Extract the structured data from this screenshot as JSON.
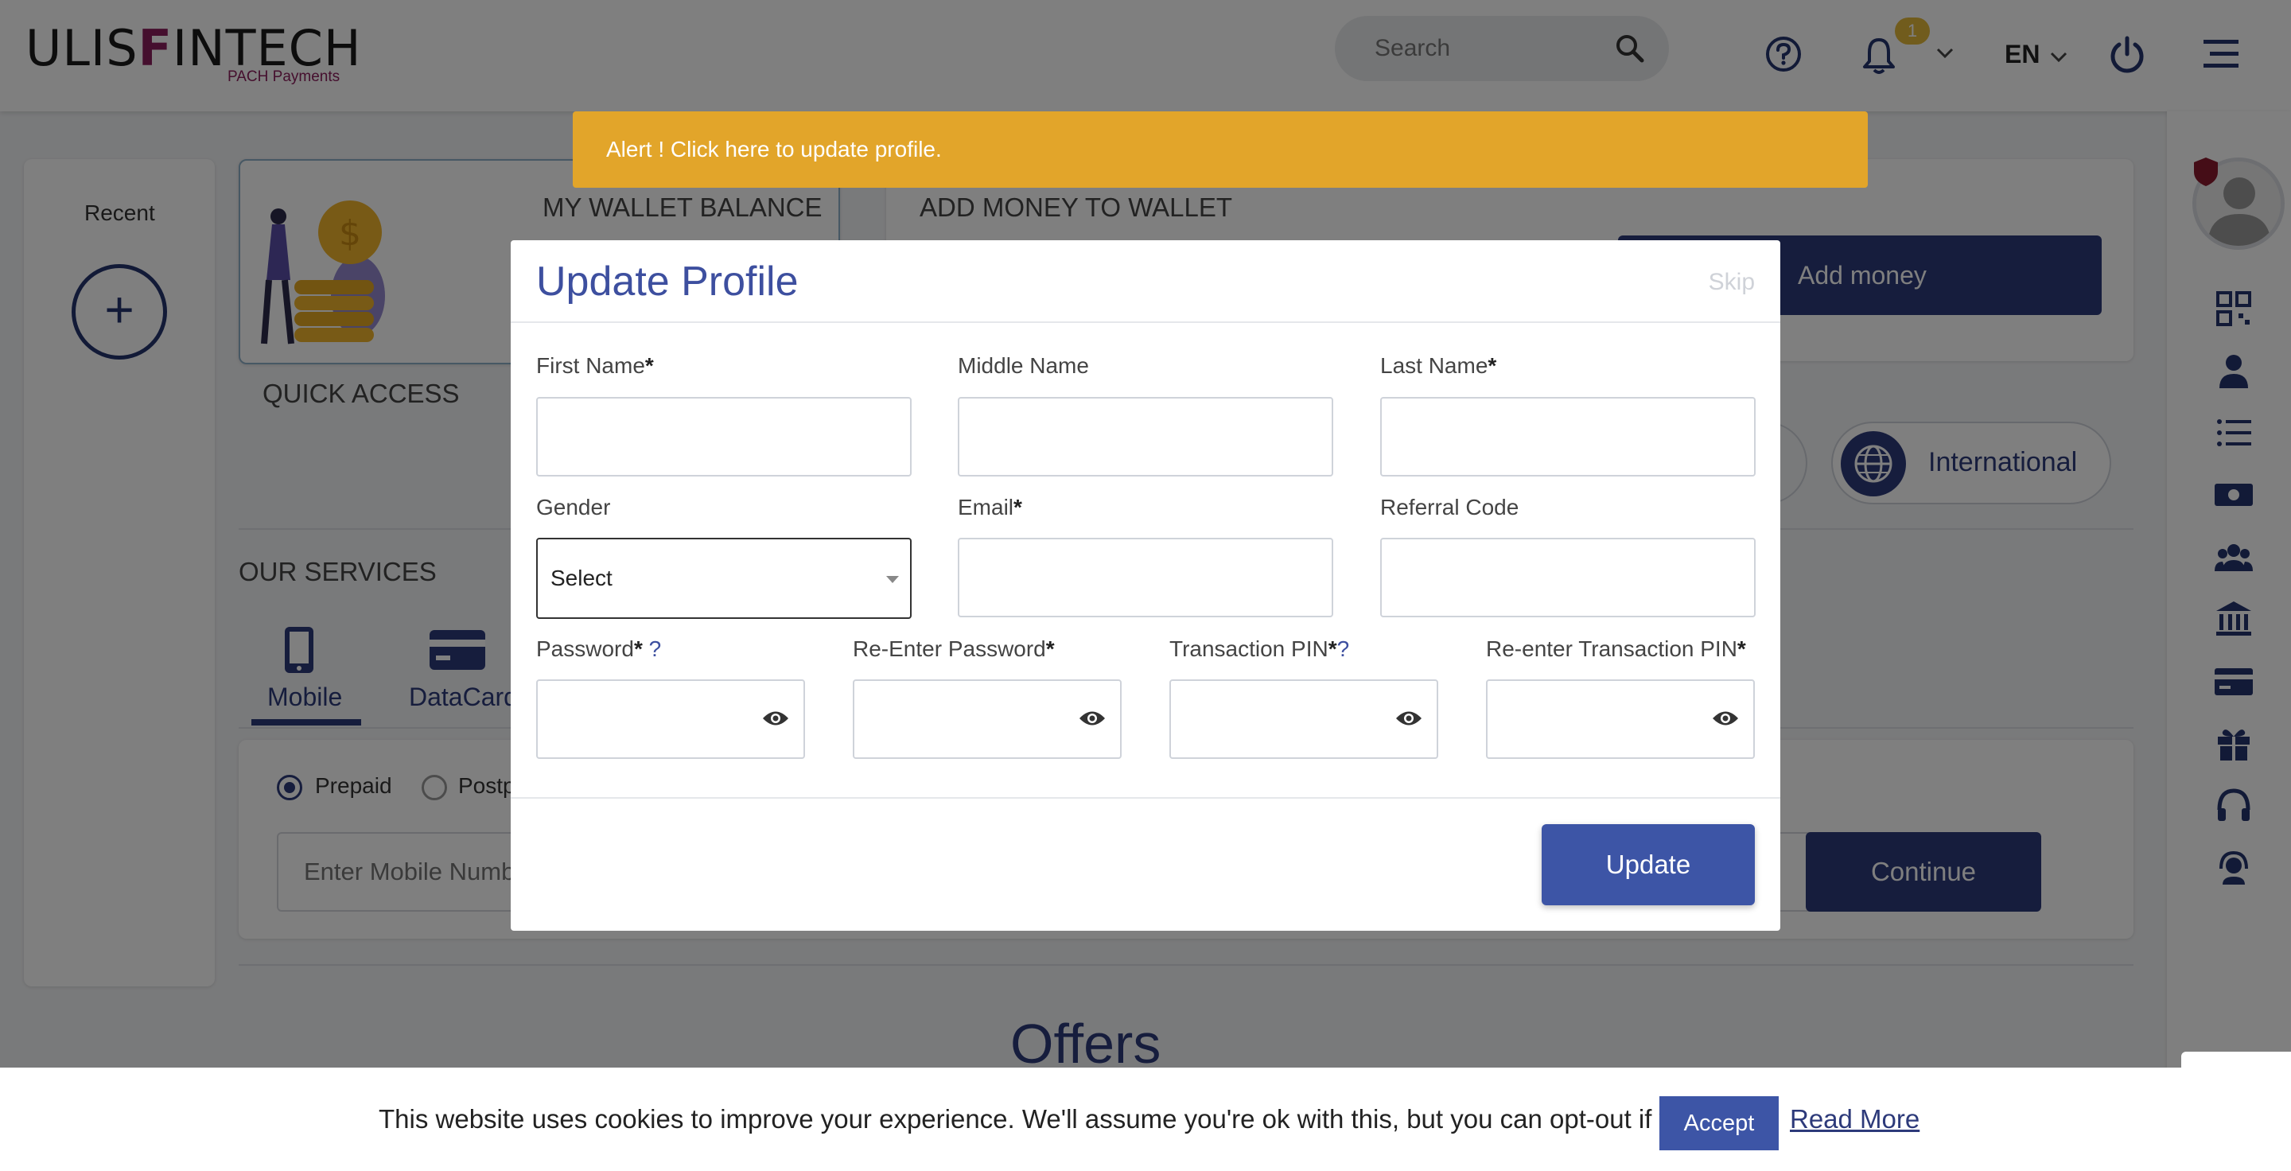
{
  "header": {
    "logo_text_1": "ULIS",
    "logo_text_f": "F",
    "logo_text_2": "INTECH",
    "logo_sub": "PACH Payments",
    "search_placeholder": "Search",
    "notification_count": "1",
    "language": "EN"
  },
  "alert": {
    "text": "Alert ! Click here to update profile."
  },
  "dashboard": {
    "recent_title": "Recent",
    "add_icon": "+",
    "wallet_balance_title": "MY WALLET BALANCE",
    "add_money_title": "ADD MONEY TO WALLET",
    "add_money_button": "Add money",
    "quick_access_title": "QUICK ACCESS",
    "international_label": "International",
    "services_title": "OUR SERVICES",
    "service_tabs": [
      "Mobile",
      "DataCard"
    ],
    "radio_prepaid": "Prepaid",
    "radio_postpaid_partial": "Postp",
    "mobile_input_placeholder": "Enter Mobile Number",
    "continue_button": "Continue",
    "offers_title": "Offers"
  },
  "modal": {
    "title": "Update Profile",
    "skip": "Skip",
    "fields": {
      "first_name": "First Name",
      "middle_name": "Middle Name",
      "last_name": "Last Name",
      "gender": "Gender",
      "email": "Email",
      "referral_code": "Referral Code",
      "password": "Password",
      "reenter_password": "Re-Enter Password",
      "transaction_pin": "Transaction PIN",
      "reenter_transaction_pin": "Re-enter Transaction PIN"
    },
    "required_mark": "*",
    "help_mark": "?",
    "gender_selected": "Select",
    "update_button": "Update"
  },
  "cookie": {
    "text": "This website uses cookies to improve your experience. We'll assume you're ok with this, but you can opt-out if you wish.",
    "accept": "Accept",
    "read_more": "Read More"
  },
  "colors": {
    "brand_navy": "#2d3a7a",
    "modal_blue": "#3d55a6",
    "alert_amber": "#e2a52a",
    "logo_magenta": "#8b1e5c"
  },
  "icons": {
    "search": "search-icon",
    "help": "help-circle-icon",
    "bell": "bell-icon",
    "power": "power-icon",
    "menu": "menu-icon",
    "eye": "eye-icon",
    "rail": [
      "qr-code-icon",
      "user-icon",
      "list-icon",
      "money-icon",
      "group-icon",
      "bank-icon",
      "card-icon",
      "gift-icon",
      "headphones-icon",
      "support-agent-icon"
    ]
  }
}
